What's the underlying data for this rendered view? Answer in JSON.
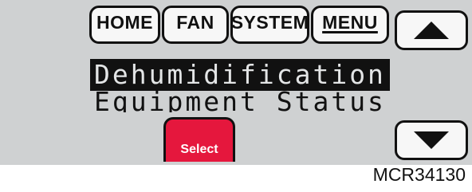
{
  "tabs": {
    "home": "HOME",
    "fan": "FAN",
    "system": "SYSTEM",
    "menu": "MENU"
  },
  "menu_items": {
    "selected": "Dehumidification",
    "next": "Equipment Status"
  },
  "buttons": {
    "select": "Select",
    "up_icon": "up-arrow-icon",
    "down_icon": "down-arrow-icon"
  },
  "colors": {
    "screen_bg": "#cfd1d2",
    "select_button": "#e5173d",
    "highlight_bg": "#111111"
  },
  "caption": "MCR34130"
}
